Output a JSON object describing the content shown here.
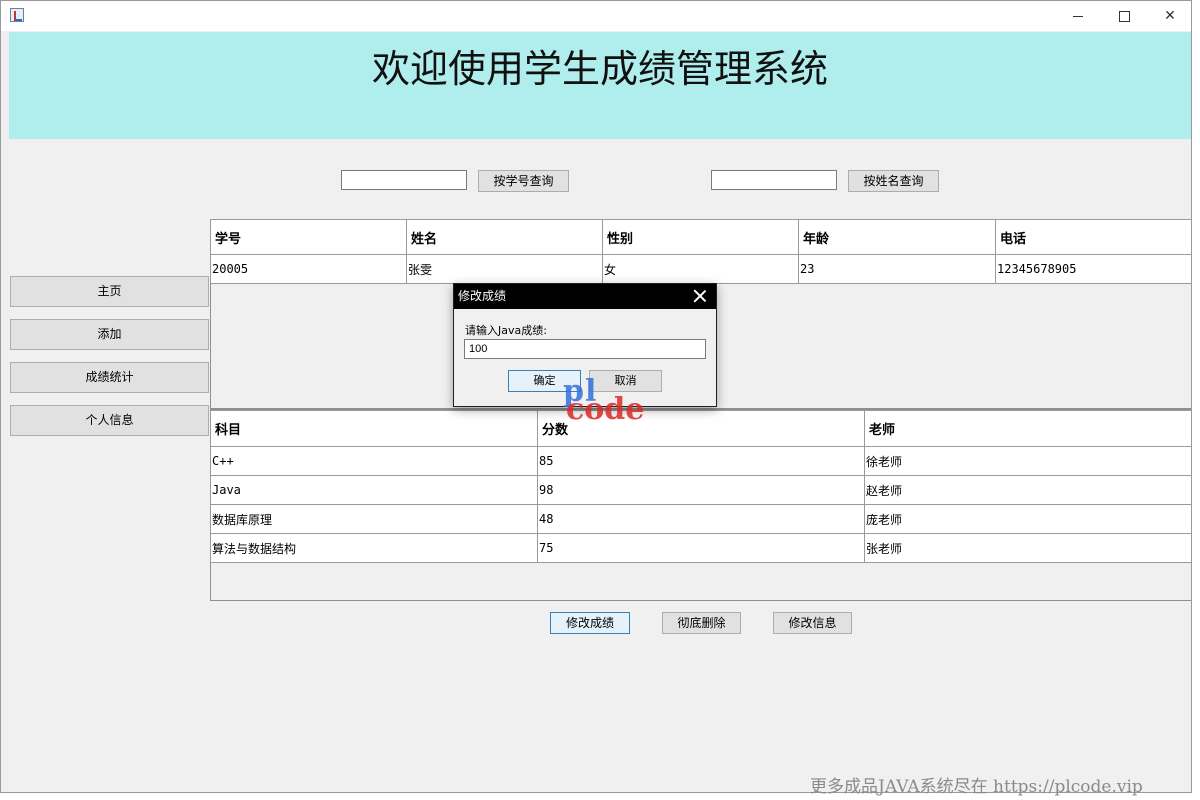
{
  "banner": {
    "title": "欢迎使用学生成绩管理系统"
  },
  "search": {
    "by_id": {
      "value": "",
      "button": "按学号查询"
    },
    "by_name": {
      "value": "",
      "button": "按姓名查询"
    }
  },
  "nav": {
    "items": [
      {
        "label": "主页"
      },
      {
        "label": "添加"
      },
      {
        "label": "成绩统计"
      },
      {
        "label": "个人信息"
      }
    ]
  },
  "student_table": {
    "headers": [
      "学号",
      "姓名",
      "性别",
      "年龄",
      "电话"
    ],
    "rows": [
      [
        "20005",
        "张雯",
        "女",
        "23",
        "12345678905"
      ]
    ]
  },
  "score_table": {
    "headers": [
      "科目",
      "分数",
      "老师"
    ],
    "rows": [
      [
        "C++",
        "85",
        "徐老师"
      ],
      [
        "Java",
        "98",
        "赵老师"
      ],
      [
        "数据库原理",
        "48",
        "庞老师"
      ],
      [
        "算法与数据结构",
        "75",
        "张老师"
      ]
    ]
  },
  "actions": {
    "edit_score": "修改成绩",
    "delete": "彻底删除",
    "edit_info": "修改信息"
  },
  "dialog": {
    "title": "修改成绩",
    "prompt": "请输入Java成绩:",
    "value": "100",
    "ok": "确定",
    "cancel": "取消"
  },
  "watermark": {
    "logo_top": "pl",
    "logo_bottom": "code",
    "footer": "更多成品JAVA系统尽在 https://plcode.vip"
  }
}
